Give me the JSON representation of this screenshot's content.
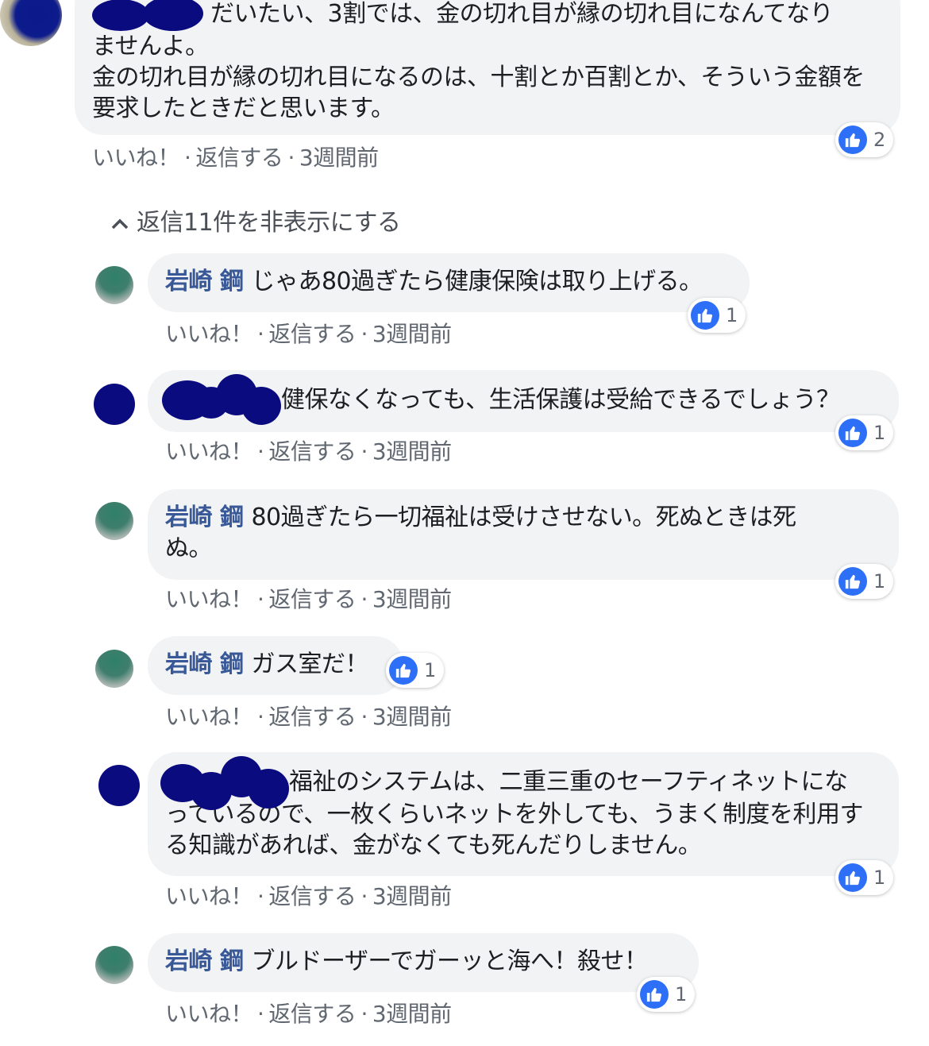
{
  "top_comment": {
    "text_line1": "だいたい、3割では、金の切れ目が縁の切れ目になんてなり",
    "text_rest": "ませんよ。\n金の切れ目が縁の切れ目になるのは、十割とか百割とか、そういう金額を要求したときだと思います。",
    "likes": "2"
  },
  "actions": {
    "like": "いいね！",
    "reply": "返信する",
    "sep": "·"
  },
  "toggle": {
    "chevron": "^",
    "label": "返信11件を非表示にする"
  },
  "replies": [
    {
      "author": "岩崎 鋼",
      "text": "じゃあ80過ぎたら健康保険は取り上げる。",
      "likes": "1",
      "time": "3週間前"
    },
    {
      "author": "",
      "text": "健保なくなっても、生活保護は受給できるでしょう？",
      "likes": "1",
      "time": "3週間前"
    },
    {
      "author": "岩崎 鋼",
      "text": "80過ぎたら一切福祉は受けさせない。死ぬときは死ぬ。",
      "likes": "1",
      "time": "3週間前"
    },
    {
      "author": "岩崎 鋼",
      "text": "ガス室だ！",
      "likes": "1",
      "time": "3週間前"
    },
    {
      "author": "",
      "text": "福祉のシステムは、二重三重のセーフティネットになっているので、一枚くらいネットを外しても、うまく制度を利用する知識があれば、金がなくても死んだりしません。",
      "likes": "1",
      "time": "3週間前"
    },
    {
      "author": "岩崎 鋼",
      "text": "ブルドーザーでガーッと海へ！殺せ！",
      "likes": "1",
      "time": "3週間前"
    }
  ],
  "top_time": "3週間前",
  "colors": {
    "like_blue": "#2d6ff7",
    "author_blue": "#385898",
    "bubble_bg": "#f2f3f5",
    "redaction": "#0b0b80"
  }
}
